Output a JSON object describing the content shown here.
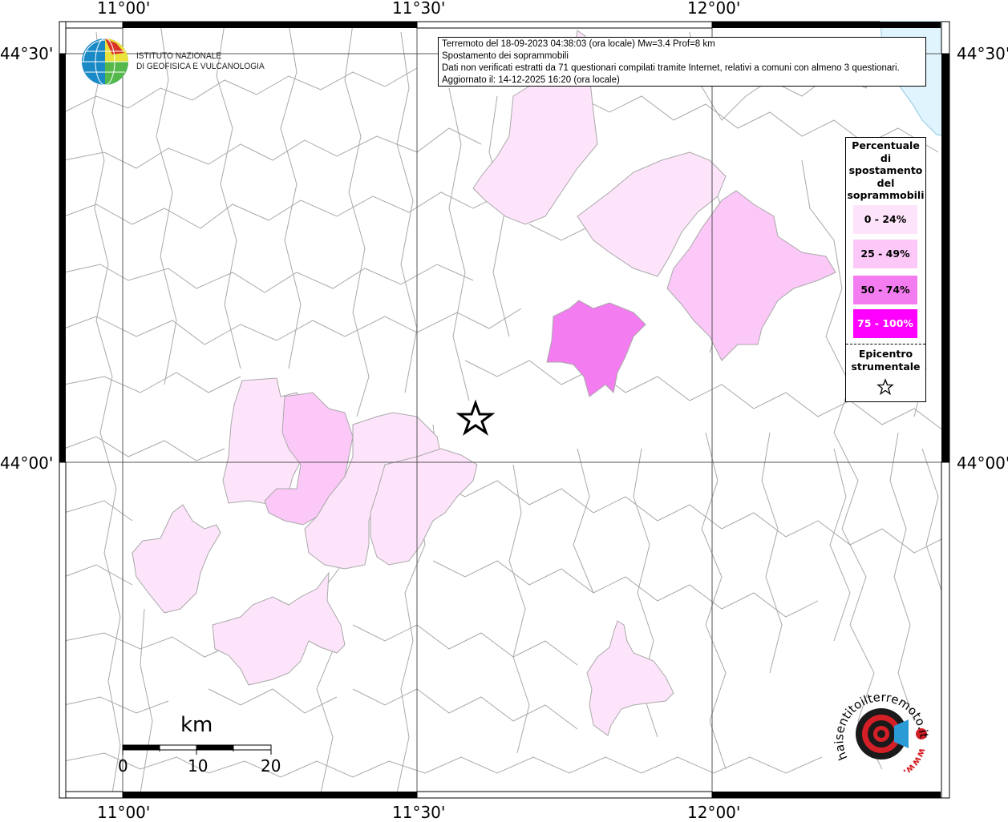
{
  "axes": {
    "top_labels": [
      "11°00'",
      "11°30'",
      "12°00'"
    ],
    "bottom_labels": [
      "11°00'",
      "11°30'",
      "12°00'"
    ],
    "left_labels": [
      "44°30'",
      "44°00'"
    ],
    "right_labels": [
      "44°30'",
      "44°00'"
    ]
  },
  "info_box": {
    "line1": "Terremoto del 18-09-2023 04:38:03 (ora locale) Mw=3.4 Prof=8 km",
    "line2": "Spostamento dei soprammobili",
    "line3": "Dati non verificati estratti da 71 questionari compilati tramite Internet, relativi a comuni con almeno 3 questionari.",
    "line4": "Aggiornato il: 14-12-2025 16:20 (ora locale)"
  },
  "logo": {
    "name_line1": "ISTITUTO NAZIONALE",
    "name_line2": "DI GEOFISICA E VULCANOLOGIA",
    "icon": "ingv-globe-logo"
  },
  "legend": {
    "title": "Percentuale di spostamento del soprammobili",
    "classes": [
      {
        "label": "0 - 24%",
        "color": "#fde4fa"
      },
      {
        "label": "25 - 49%",
        "color": "#fbc8f7"
      },
      {
        "label": "50 - 74%",
        "color": "#f47cf1"
      },
      {
        "label": "75 - 100%",
        "color": "#ff00ff"
      }
    ],
    "epicenter_label": "Epicentro strumentale",
    "epicenter_icon": "star-icon"
  },
  "scale_bar": {
    "unit": "km",
    "ticks": [
      "0",
      "10",
      "20"
    ]
  },
  "watermark": {
    "text": "haisentitoilterremoto.it",
    "url_text": "www.",
    "icon": "haisentito-logo"
  },
  "colors": {
    "sea": "#dff4fd",
    "border": "#a9a9a9",
    "grid": "#555555"
  }
}
